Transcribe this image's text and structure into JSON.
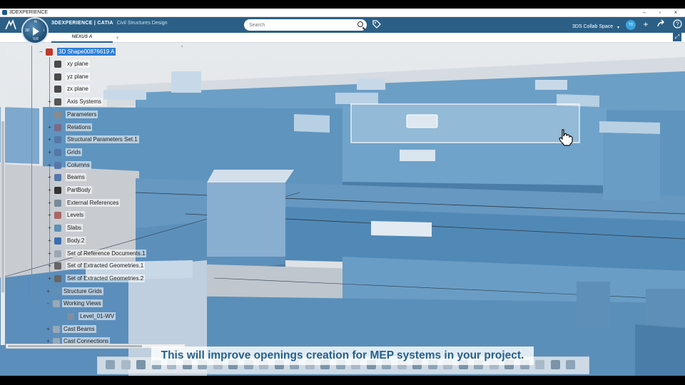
{
  "window": {
    "title": "3DEXPERIENCE"
  },
  "header": {
    "brand_bold": "3DEXPERIENCE | CATIA",
    "brand_app": "Civil Structures Design",
    "compass_label_top": "N",
    "compass_label_left": "3D",
    "compass_label_right": "i",
    "compass_label_bottom": "V,R",
    "search_placeholder": "Search",
    "collab_space": "3DS Collab Space",
    "avatar_initials": "TD"
  },
  "tabs": [
    {
      "label": "NEXUS A"
    }
  ],
  "tree": {
    "root": "3D Shape00876619 A",
    "items": [
      {
        "label": "xy plane",
        "indent": 1,
        "expand": ""
      },
      {
        "label": "yz plane",
        "indent": 1,
        "expand": ""
      },
      {
        "label": "zx plane",
        "indent": 1,
        "expand": ""
      },
      {
        "label": "Axis Systems",
        "indent": 1,
        "expand": "+"
      },
      {
        "label": "Parameters",
        "indent": 1,
        "expand": ""
      },
      {
        "label": "Relations",
        "indent": 1,
        "expand": "+"
      },
      {
        "label": "Structural Parameters Set.1",
        "indent": 1,
        "expand": "+"
      },
      {
        "label": "Grids",
        "indent": 1,
        "expand": "+"
      },
      {
        "label": "Columns",
        "indent": 1,
        "expand": "+"
      },
      {
        "label": "Beams",
        "indent": 1,
        "expand": "+"
      },
      {
        "label": "PartBody",
        "indent": 1,
        "expand": "+"
      },
      {
        "label": "External References",
        "indent": 1,
        "expand": "+"
      },
      {
        "label": "Levels",
        "indent": 1,
        "expand": "+"
      },
      {
        "label": "Slabs",
        "indent": 1,
        "expand": "+"
      },
      {
        "label": "Body.2",
        "indent": 1,
        "expand": "+"
      },
      {
        "label": "Set of Reference Documents.1",
        "indent": 1,
        "expand": "+"
      },
      {
        "label": "Set of Extracted Geometries.1",
        "indent": 1,
        "expand": "+"
      },
      {
        "label": "Set of Extracted Geometries.2",
        "indent": 1,
        "expand": "+"
      },
      {
        "label": "Structure Grids",
        "indent": 0,
        "expand": "+"
      },
      {
        "label": "Working Views",
        "indent": 0,
        "expand": "-"
      },
      {
        "label": "Level_01-WV",
        "indent": 1,
        "expand": ""
      },
      {
        "label": "Cast Beams",
        "indent": 0,
        "expand": "+"
      },
      {
        "label": "Cast Connections",
        "indent": 0,
        "expand": "+"
      }
    ]
  },
  "subtitle": "This will improve openings creation for MEP systems in your project.",
  "colors": {
    "accent": "#2b5f86",
    "structure_top": "#6b9fc8",
    "structure_side": "#4e82ad",
    "column_top": "#b8d0e3",
    "subtitle_text": "#23618f",
    "selection": "#2d7fd6"
  },
  "icons": {
    "search": "search-icon",
    "tag": "tag-icon",
    "add": "plus-icon",
    "share": "share-icon",
    "help": "help-icon"
  }
}
